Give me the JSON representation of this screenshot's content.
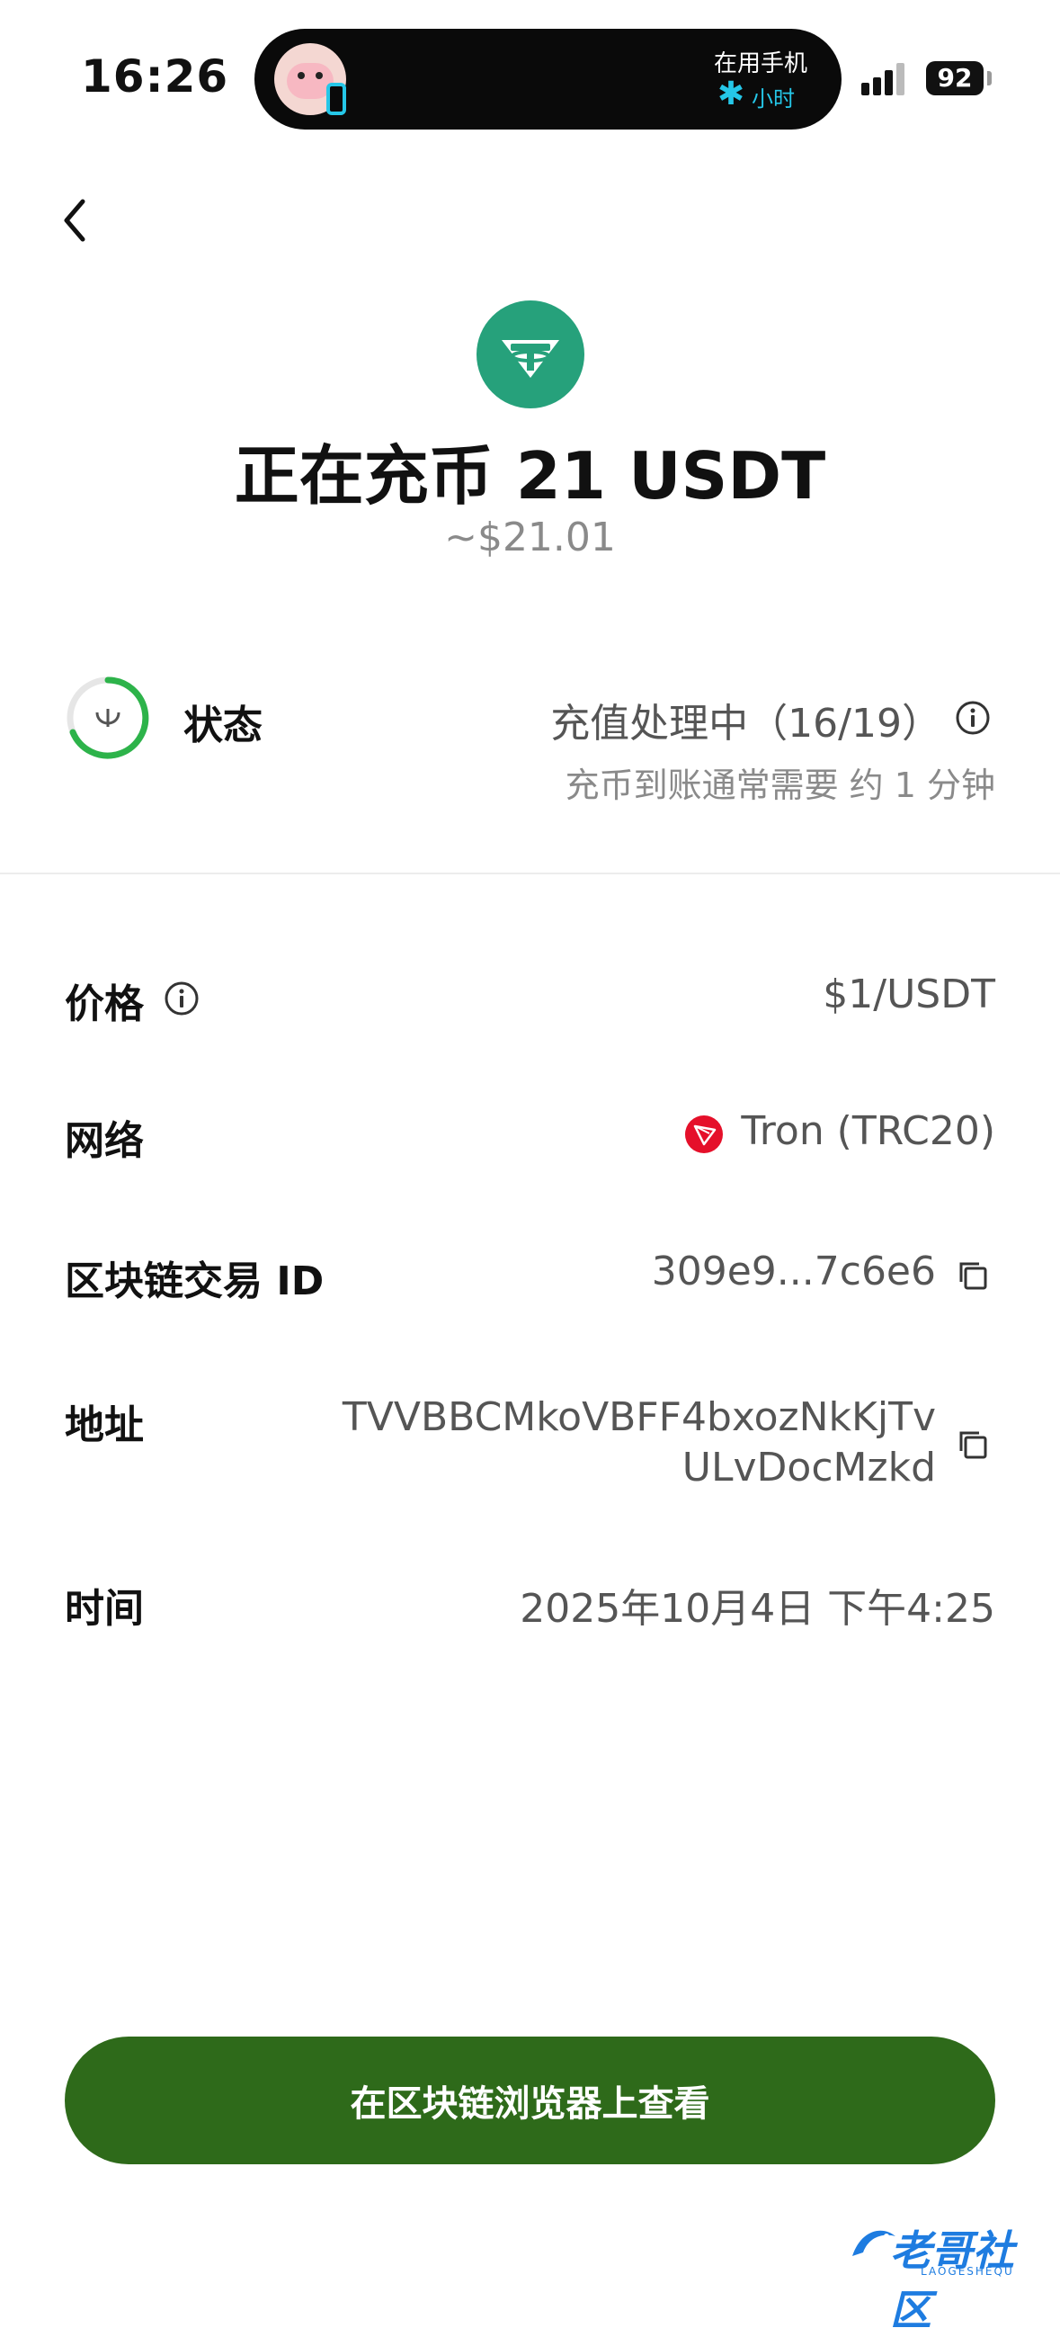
{
  "status_bar": {
    "time": "16:26",
    "island_line1": "在用手机",
    "island_line2": "小时",
    "battery": "92"
  },
  "header": {
    "title": "正在充币 21 USDT",
    "subtitle": "~$21.01"
  },
  "status": {
    "label": "状态",
    "text": "充值处理中（16/19）",
    "note": "充币到账通常需要 约 1 分钟"
  },
  "rows": {
    "price": {
      "label": "价格",
      "value": "$1/USDT"
    },
    "network": {
      "label": "网络",
      "value": "Tron (TRC20)"
    },
    "txid": {
      "label": "区块链交易 ID",
      "value": "309e9...7c6e6"
    },
    "address": {
      "label": "地址",
      "value_line1": "TVVBBCMkoVBFF4bxozNkKjTv",
      "value_line2": "ULvDocMzkd"
    },
    "time": {
      "label": "时间",
      "value": "2025年10月4日 下午4:25"
    }
  },
  "button": {
    "label": "在区块链浏览器上查看"
  },
  "watermark": {
    "text": "老哥社区",
    "sub": "LAOGESHEQU"
  },
  "colors": {
    "accent_green": "#2e6a1a",
    "status_green": "#2db34a",
    "usdt_teal": "#26a17b",
    "tron_red": "#e5102a"
  },
  "icons": {
    "back": "chevron-left-icon",
    "usdt": "usdt-icon",
    "status": "progress-ring-icon",
    "info": "info-icon",
    "tron": "tron-icon",
    "copy": "copy-icon"
  }
}
